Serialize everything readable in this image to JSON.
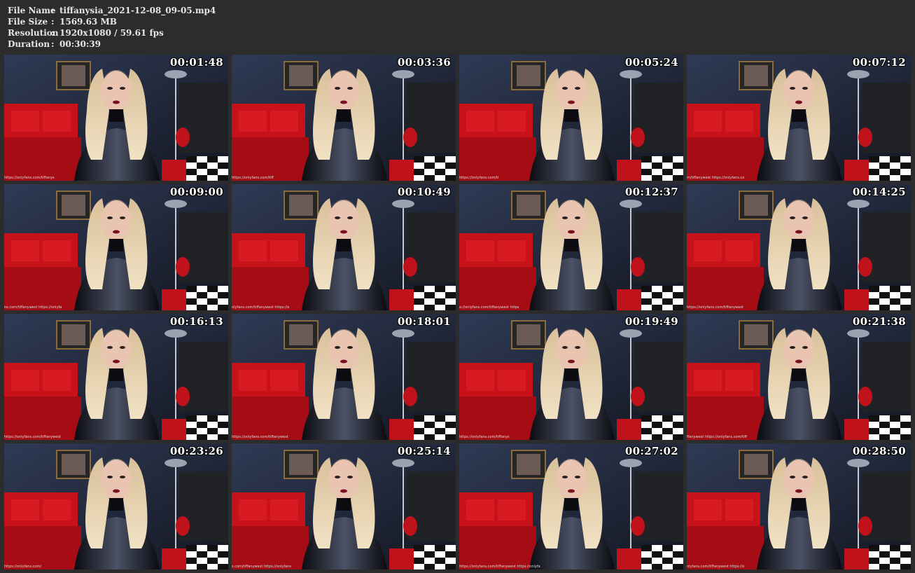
{
  "file_info": {
    "file_name": {
      "key": "File Name",
      "value": "tiffanysia_2021-12-08_09-05.mp4"
    },
    "file_size": {
      "key": "File Size",
      "value": "1569.63 MB"
    },
    "resolution": {
      "key": "Resolution",
      "value": "1920x1080 / 59.61 fps"
    },
    "duration": {
      "key": "Duration",
      "value": "00:30:39"
    },
    "separator": ":"
  },
  "thumbnails": [
    {
      "timestamp": "00:01:48",
      "watermark": "https://onlyfans.com/tiffanys"
    },
    {
      "timestamp": "00:03:36",
      "watermark": "https://onlyfans.com/tiff"
    },
    {
      "timestamp": "00:05:24",
      "watermark": "https://onlyfans.com/ti"
    },
    {
      "timestamp": "00:07:12",
      "watermark": "m/tiffanywest   https://onlyfans.co"
    },
    {
      "timestamp": "00:09:00",
      "watermark": "ns.com/tiffanywest   https://onlyfa"
    },
    {
      "timestamp": "00:10:49",
      "watermark": "nlyfans.com/tiffanywest   https://o"
    },
    {
      "timestamp": "00:12:37",
      "watermark": "o://onlyfans.com/tiffanywest   https"
    },
    {
      "timestamp": "00:14:25",
      "watermark": "https://onlyfans.com/tiffanywest"
    },
    {
      "timestamp": "00:16:13",
      "watermark": "https://onlyfans.com/tiffanywest"
    },
    {
      "timestamp": "00:18:01",
      "watermark": "https://onlyfans.com/tiffanywest"
    },
    {
      "timestamp": "00:19:49",
      "watermark": "https://onlyfans.com/tiffanys"
    },
    {
      "timestamp": "00:21:38",
      "watermark": "ffanywest   https://onlyfans.com/tiff"
    },
    {
      "timestamp": "00:23:26",
      "watermark": "https://onlyfans.com/"
    },
    {
      "timestamp": "00:25:14",
      "watermark": "s.com/tiffanywest   https://onlyfans"
    },
    {
      "timestamp": "00:27:02",
      "watermark": "https://onlyfans.com/tiffanywest   https://onlyfa"
    },
    {
      "timestamp": "00:28:50",
      "watermark": "nlyfans.com/tiffanywest   https://o"
    }
  ],
  "colors": {
    "background": "#2c2c2c",
    "text": "#e6e6e6",
    "sofa_red": "#c8121a",
    "wall_dark": "#1e2230"
  }
}
